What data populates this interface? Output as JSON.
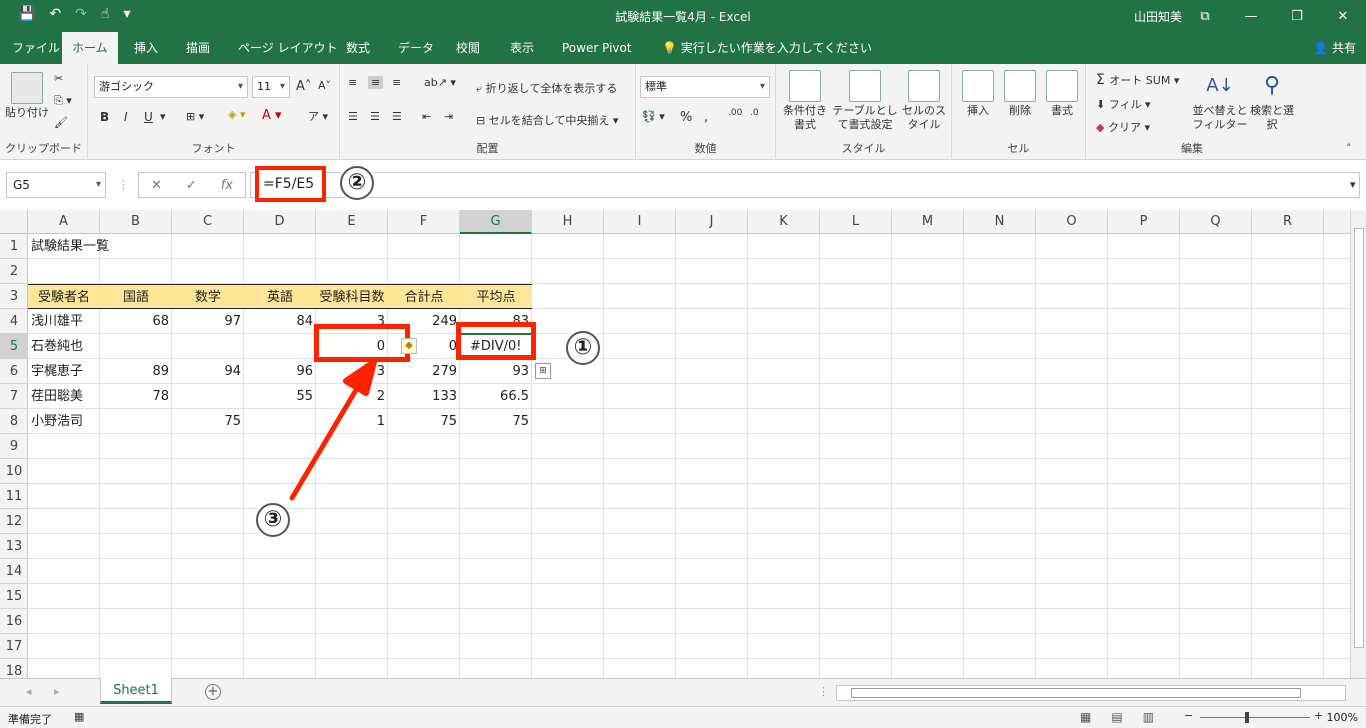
{
  "window": {
    "title": "試験結果一覧4月  -  Excel",
    "user": "山田知美",
    "qat_save": "💾",
    "qat_undo": "↶",
    "qat_redo": "↷",
    "win_restore": "⧉",
    "win_minimize": "—",
    "win_maximize": "❐",
    "win_close": "✕"
  },
  "tabs": [
    "ファイル",
    "ホーム",
    "挿入",
    "描画",
    "ページ レイアウト",
    "数式",
    "データ",
    "校閲",
    "表示",
    "Power Pivot",
    "💡 実行したい作業を入力してください"
  ],
  "share_label": "共有",
  "ribbon": {
    "clipboard": {
      "label": "クリップボード",
      "paste": "貼り付け"
    },
    "font": {
      "label": "フォント",
      "name": "游ゴシック",
      "size": "11",
      "bold": "B",
      "italic": "I",
      "underline": "U"
    },
    "align": {
      "label": "配置",
      "wrap": "折り返して全体を表示する",
      "merge": "セルを結合して中央揃え"
    },
    "number": {
      "label": "数値",
      "format": "標準",
      "percent": "%",
      "comma": ","
    },
    "styles": {
      "label": "スタイル",
      "cond": "条件付き書式",
      "table": "テーブルとして書式設定",
      "cell": "セルのスタイル"
    },
    "cells": {
      "label": "セル",
      "insert": "挿入",
      "delete": "削除",
      "format": "書式"
    },
    "edit": {
      "label": "編集",
      "autosum": "オート SUM",
      "fill": "フィル",
      "clear": "クリア",
      "sort": "並べ替えとフィルター",
      "find": "検索と選択"
    }
  },
  "formula_bar": {
    "namebox": "G5",
    "formula": "=F5/E5",
    "cancel": "✕",
    "enter": "✓",
    "fx": "fx"
  },
  "columns": [
    "A",
    "B",
    "C",
    "D",
    "E",
    "F",
    "G",
    "H",
    "I",
    "J",
    "K",
    "L",
    "M",
    "N",
    "O",
    "P",
    "Q",
    "R"
  ],
  "rows": [
    "1",
    "2",
    "3",
    "4",
    "5",
    "6",
    "7",
    "8",
    "9",
    "10",
    "11",
    "12",
    "13",
    "14",
    "15",
    "16",
    "17",
    "18"
  ],
  "sheet": {
    "title": "試験結果一覧",
    "headers": [
      "受験者名",
      "国語",
      "数学",
      "英語",
      "受験科目数",
      "合計点",
      "平均点"
    ],
    "data": [
      {
        "name": "浅川雄平",
        "b": "68",
        "c": "97",
        "d": "84",
        "e": "3",
        "f": "249",
        "g": "83"
      },
      {
        "name": "石巻純也",
        "b": "",
        "c": "",
        "d": "",
        "e": "0",
        "f": "0",
        "g": "#DIV/0!"
      },
      {
        "name": "宇梶恵子",
        "b": "89",
        "c": "94",
        "d": "96",
        "e": "3",
        "f": "279",
        "g": "93"
      },
      {
        "name": "荏田聡美",
        "b": "78",
        "c": "",
        "d": "55",
        "e": "2",
        "f": "133",
        "g": "66.5"
      },
      {
        "name": "小野浩司",
        "b": "",
        "c": "75",
        "d": "",
        "e": "1",
        "f": "75",
        "g": "75"
      }
    ]
  },
  "annotations": {
    "one": "①",
    "two": "②",
    "three": "③"
  },
  "sheet_tab": "Sheet1",
  "status": {
    "ready": "準備完了",
    "zoom": "100%"
  },
  "colors": {
    "excel_green": "#217346",
    "header_fill": "#ffe699",
    "annotation_red": "#ff2200"
  }
}
